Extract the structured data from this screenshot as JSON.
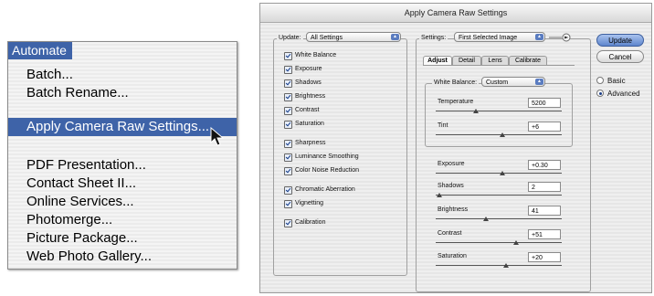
{
  "menu": {
    "title": "Automate",
    "items": [
      {
        "label": "Batch..."
      },
      {
        "label": "Batch Rename..."
      },
      {
        "label": "Apply Camera Raw Settings...",
        "selected": true
      },
      {
        "label": "PDF Presentation..."
      },
      {
        "label": "Contact Sheet II..."
      },
      {
        "label": "Online Services..."
      },
      {
        "label": "Photomerge..."
      },
      {
        "label": "Picture Package..."
      },
      {
        "label": "Web Photo Gallery..."
      }
    ]
  },
  "dialog": {
    "title": "Apply Camera Raw Settings",
    "update_label": "Update:",
    "update_value": "All Settings",
    "checkboxes": [
      "White Balance",
      "Exposure",
      "Shadows",
      "Brightness",
      "Contrast",
      "Saturation",
      "Sharpness",
      "Luminance Smoothing",
      "Color Noise Reduction",
      "Chromatic Aberration",
      "Vignetting",
      "Calibration"
    ],
    "settings_label": "Settings:",
    "settings_value": "First Selected Image",
    "tabs": [
      "Adjust",
      "Detail",
      "Lens",
      "Calibrate"
    ],
    "white_balance_label": "White Balance:",
    "white_balance_value": "Custom",
    "sliders": [
      {
        "label": "Temperature",
        "value": "5200",
        "pos": 0.32
      },
      {
        "label": "Tint",
        "value": "+6",
        "pos": 0.53
      },
      {
        "label": "Exposure",
        "value": "+0.30",
        "pos": 0.53
      },
      {
        "label": "Shadows",
        "value": "2",
        "pos": 0.03
      },
      {
        "label": "Brightness",
        "value": "41",
        "pos": 0.4
      },
      {
        "label": "Contrast",
        "value": "+51",
        "pos": 0.64
      },
      {
        "label": "Saturation",
        "value": "+20",
        "pos": 0.56
      }
    ],
    "buttons": {
      "update": "Update",
      "cancel": "Cancel"
    },
    "modes": [
      {
        "label": "Basic",
        "selected": false
      },
      {
        "label": "Advanced",
        "selected": true
      }
    ]
  }
}
